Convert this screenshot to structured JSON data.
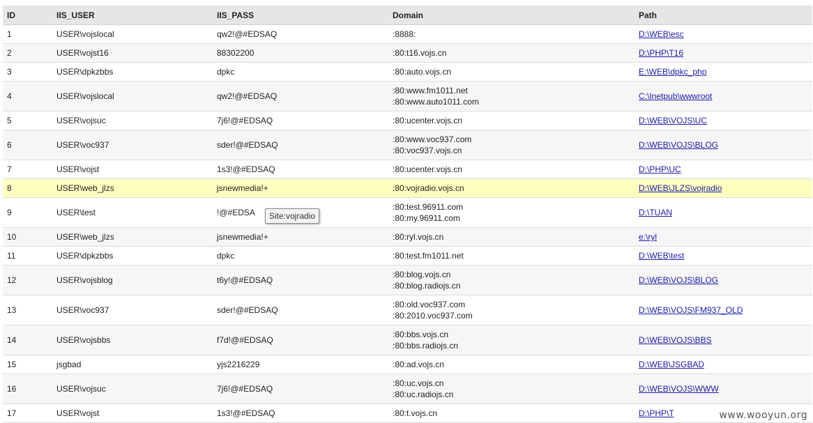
{
  "columns": [
    "ID",
    "IIS_USER",
    "IIS_PASS",
    "Domain",
    "Path"
  ],
  "rows": [
    {
      "id": "1",
      "user": "USER\\vojslocal",
      "pass": "qw2!@#EDSAQ",
      "domain": [
        ":8888:"
      ],
      "path": "D:\\WEB\\esc"
    },
    {
      "id": "2",
      "user": "USER\\vojst16",
      "pass": "88302200",
      "domain": [
        ":80:t16.vojs.cn"
      ],
      "path": "D:\\PHP\\T16"
    },
    {
      "id": "3",
      "user": "USER\\dpkzbbs",
      "pass": "dpkc",
      "domain": [
        ":80:auto.vojs.cn"
      ],
      "path": "E:\\WEB\\dpkc_php"
    },
    {
      "id": "4",
      "user": "USER\\vojslocal",
      "pass": "qw2!@#EDSAQ",
      "domain": [
        ":80:www.fm1011.net",
        ":80:www.auto1011.com"
      ],
      "path": "C:\\Inetpub\\wwwroot"
    },
    {
      "id": "5",
      "user": "USER\\vojsuc",
      "pass": "7j6!@#EDSAQ",
      "domain": [
        ":80:ucenter.vojs.cn"
      ],
      "path": "D:\\WEB\\VOJS\\UC"
    },
    {
      "id": "6",
      "user": "USER\\voc937",
      "pass": "sder!@#EDSAQ",
      "domain": [
        ":80:www.voc937.com",
        ":80:voc937.vojs.cn"
      ],
      "path": "D:\\WEB\\VOJS\\BLOG"
    },
    {
      "id": "7",
      "user": "USER\\vojst",
      "pass": "1s3!@#EDSAQ",
      "domain": [
        ":80:ucenter.vojs.cn"
      ],
      "path": "D:\\PHP\\UC"
    },
    {
      "id": "8",
      "user": "USER\\web_jlzs",
      "pass": "jsnewmedia!+",
      "domain": [
        ":80:vojradio.vojs.cn"
      ],
      "path": "D:\\WEB\\JLZS\\vojradio",
      "highlight": true
    },
    {
      "id": "9",
      "user": "USER\\test",
      "pass": "!@#EDSA",
      "domain": [
        ":80:test.96911.com",
        ":80:my.96911.com"
      ],
      "path": "D:\\TUAN"
    },
    {
      "id": "10",
      "user": "USER\\web_jlzs",
      "pass": "jsnewmedia!+",
      "domain": [
        ":80:ryl.vojs.cn"
      ],
      "path": "e:\\ryl"
    },
    {
      "id": "11",
      "user": "USER\\dpkzbbs",
      "pass": "dpkc",
      "domain": [
        ":80:test.fm1011.net"
      ],
      "path": "D:\\WEB\\test"
    },
    {
      "id": "12",
      "user": "USER\\vojsblog",
      "pass": "t6y!@#EDSAQ",
      "domain": [
        ":80:blog.vojs.cn",
        ":80:blog.radiojs.cn"
      ],
      "path": "D:\\WEB\\VOJS\\BLOG"
    },
    {
      "id": "13",
      "user": "USER\\voc937",
      "pass": "sder!@#EDSAQ",
      "domain": [
        ":80:old.voc937.com",
        ":80:2010.voc937.com"
      ],
      "path": "D:\\WEB\\VOJS\\FM937_OLD"
    },
    {
      "id": "14",
      "user": "USER\\vojsbbs",
      "pass": "f7d!@#EDSAQ",
      "domain": [
        ":80:bbs.vojs.cn",
        ":80:bbs.radiojs.cn"
      ],
      "path": "D:\\WEB\\VOJS\\BBS"
    },
    {
      "id": "15",
      "user": "jsgbad",
      "pass": "yjs2216229",
      "domain": [
        ":80:ad.vojs.cn"
      ],
      "path": "D:\\WEB\\JSGBAD"
    },
    {
      "id": "16",
      "user": "USER\\vojsuc",
      "pass": "7j6!@#EDSAQ",
      "domain": [
        ":80:uc.vojs.cn",
        ":80:uc.radiojs.cn"
      ],
      "path": "D:\\WEB\\VOJS\\WWW"
    },
    {
      "id": "17",
      "user": "USER\\vojst",
      "pass": "1s3!@#EDSAQ",
      "domain": [
        ":80:t.vojs.cn"
      ],
      "path": "D:\\PHP\\T"
    }
  ],
  "tooltip": "Site:vojradio",
  "watermark": "www.wooyun.org",
  "colors": {
    "header_bg": "#e6e6e6",
    "row_alt_bg": "#f6f6f6",
    "highlight_bg": "#ffffc0",
    "link": "#1a1aa6"
  }
}
